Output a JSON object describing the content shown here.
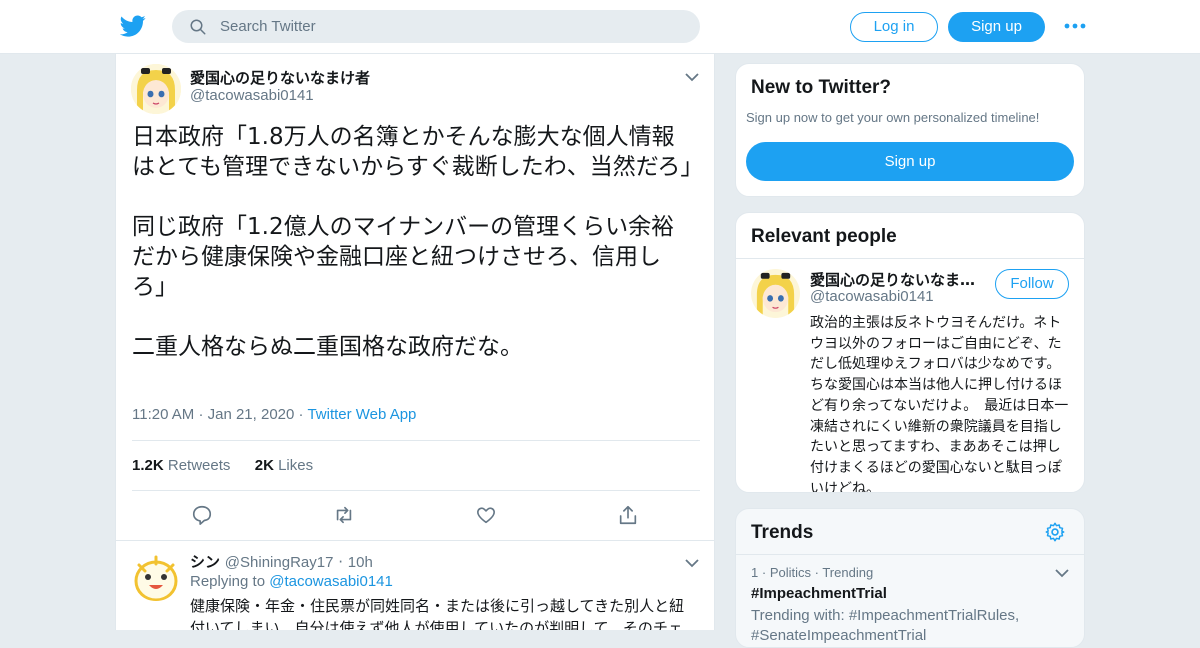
{
  "search": {
    "placeholder": "Search Twitter"
  },
  "header": {
    "login_label": "Log in",
    "signup_label": "Sign up"
  },
  "tweet": {
    "author_name": "愛国心の足りないなまけ者",
    "author_handle": "@tacowasabi0141",
    "paragraphs": [
      "日本政府「1.8万人の名簿とかそんな膨大な個人情報はとても管理できないからすぐ裁断したわ、当然だろ」",
      "同じ政府「1.2億人のマイナンバーの管理くらい余裕だから健康保険や金融口座と紐つけさせろ、信用しろ」",
      "二重人格ならぬ二重国格な政府だな。"
    ],
    "time": "11:20 AM",
    "date": "Jan 21, 2020",
    "source": "Twitter Web App",
    "retweets_count": "1.2K",
    "retweets_label": "Retweets",
    "likes_count": "2K",
    "likes_label": "Likes"
  },
  "reply": {
    "author_name": "シン",
    "author_handle": "@ShiningRay17",
    "time_ago": "10h",
    "replying_label": "Replying to",
    "replying_handle": "@tacowasabi0141",
    "text": "健康保険・年金・住民票が同姓同名・または後に引っ越してきた別人と紐付いてしまい、自分は使えず他人が使用していたのが判明して、そのチェ"
  },
  "new_to_twitter": {
    "title": "New to Twitter?",
    "subtitle": "Sign up now to get your own personalized timeline!",
    "signup_label": "Sign up"
  },
  "relevant_people": {
    "title": "Relevant people",
    "name": "愛国心の足りないなま…",
    "handle": "@tacowasabi0141",
    "follow_label": "Follow",
    "bio": "政治的主張は反ネトウヨそんだけ。ネトウヨ以外のフォローはご自由にどぞ、ただし低処理ゆえフォロバは少なめです。　ちな愛国心は本当は他人に押し付けるほど有り余ってないだけよ。　最近は日本一凍結されにくい維新の衆院議員を目指したいと思ってますわ、まああそこは押し付けまくるほどの愛国心ないと駄目っぽいけどね。"
  },
  "trends": {
    "title": "Trends",
    "items": [
      {
        "rank": "1",
        "category": "Politics",
        "status": "Trending",
        "name": "#ImpeachmentTrial",
        "with_label": "Trending with:",
        "with_tags": "#ImpeachmentTrialRules,",
        "with_tags_2": "#SenateImpeachmentTrial"
      }
    ]
  },
  "colors": {
    "accent": "#1da1f2",
    "link": "#1b95e0",
    "muted": "#657786",
    "background": "#e6ecf0"
  }
}
